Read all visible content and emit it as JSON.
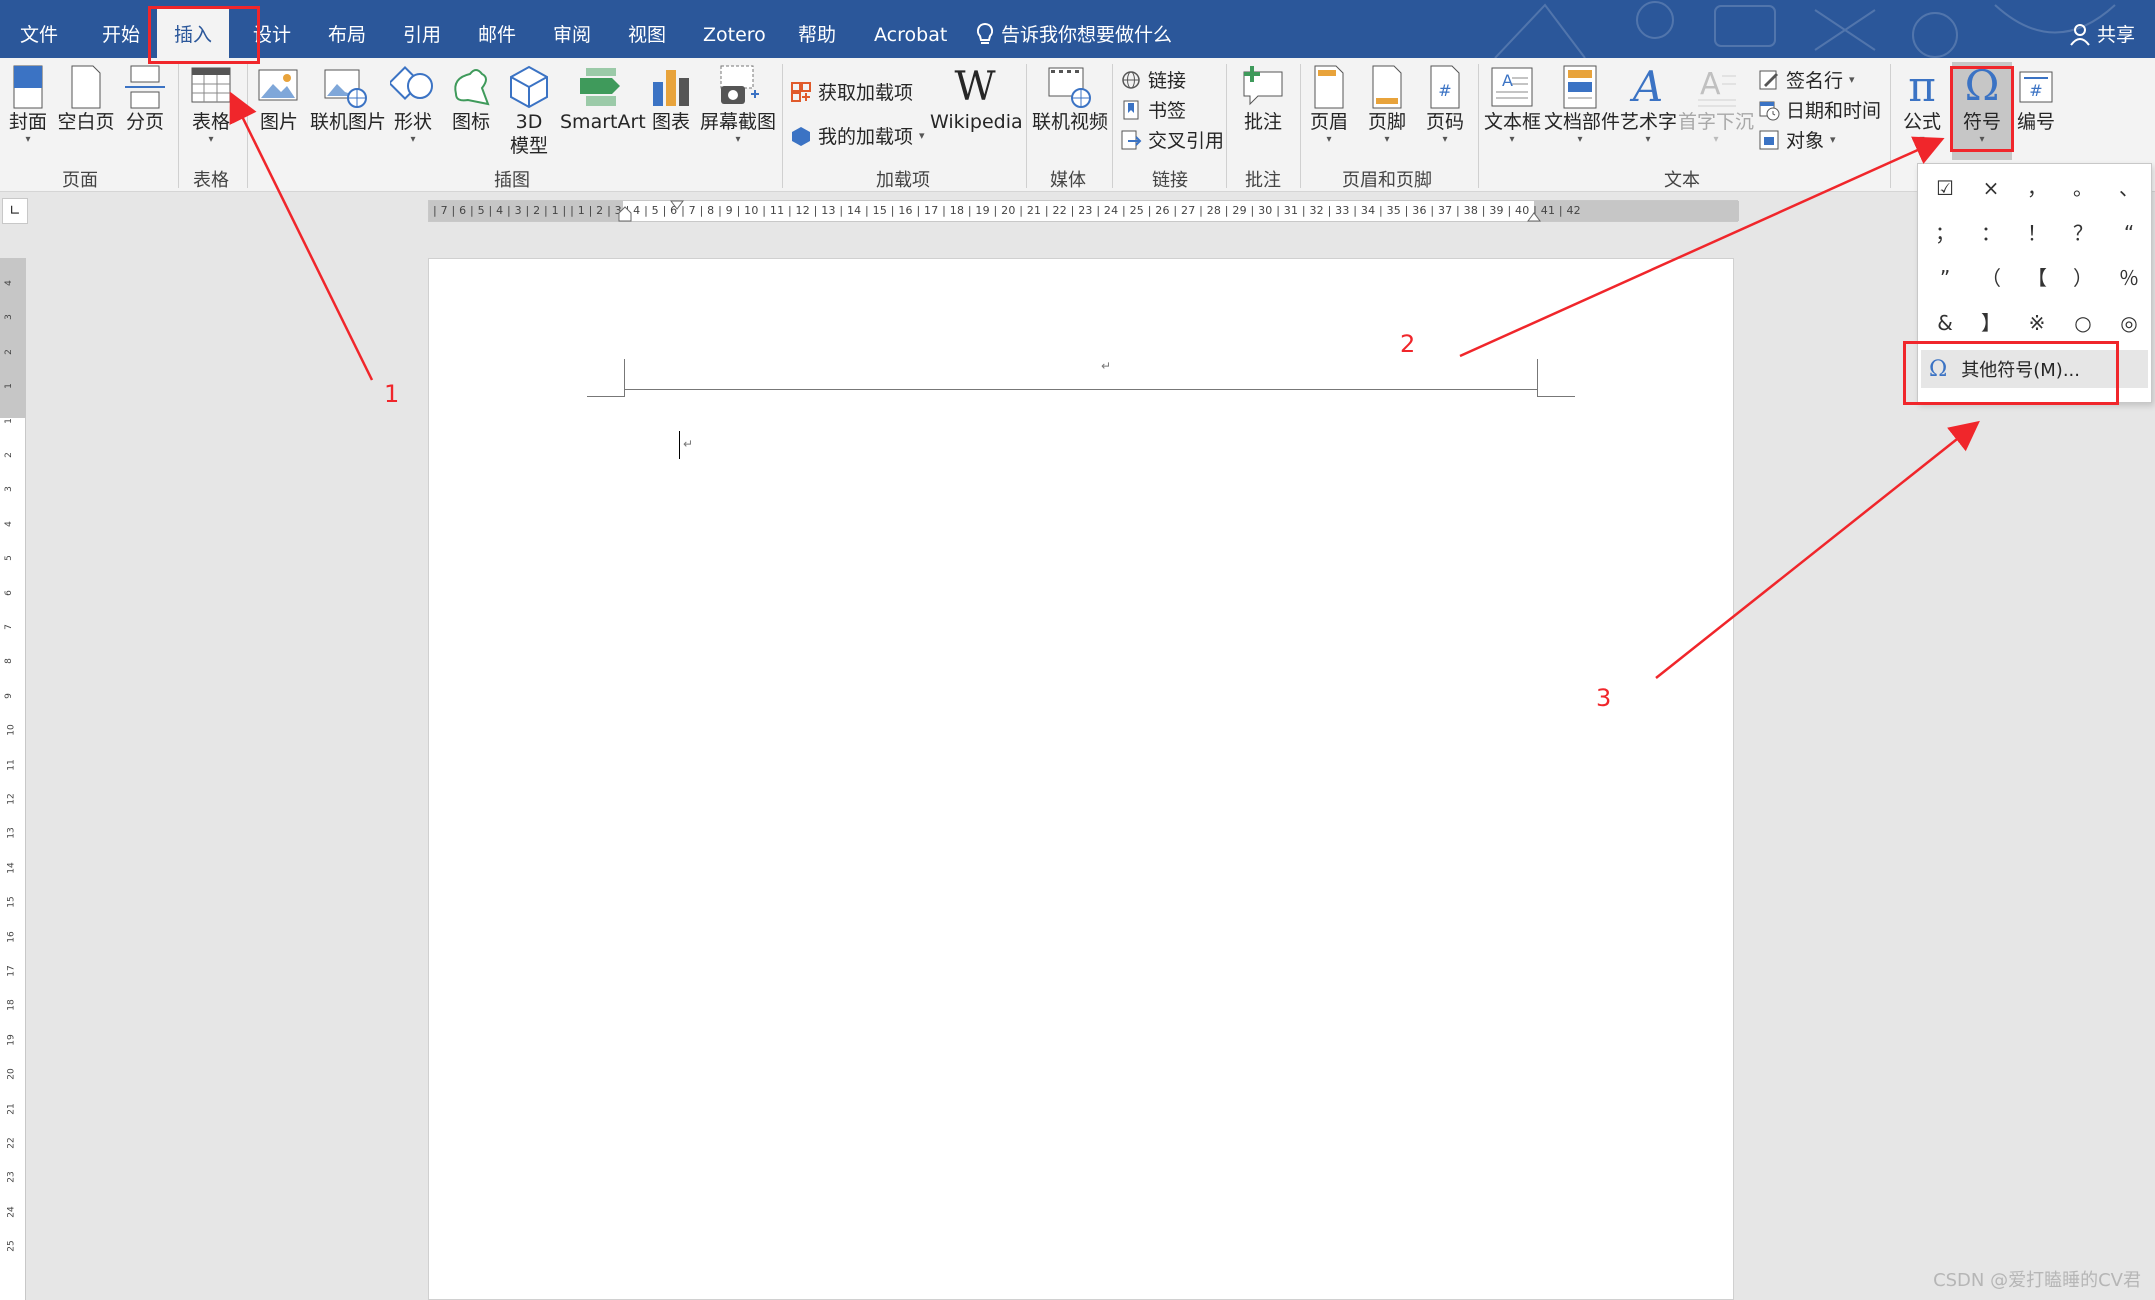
{
  "tabs": {
    "file": "文件",
    "home": "开始",
    "insert": "插入",
    "design": "设计",
    "layout": "布局",
    "references": "引用",
    "mailings": "邮件",
    "review": "审阅",
    "view": "视图",
    "zotero": "Zotero",
    "help": "帮助",
    "acrobat": "Acrobat"
  },
  "tell_me": "告诉我你想要做什么",
  "share": "共享",
  "ribbon": {
    "cover": "封面",
    "blank_page": "空白页",
    "page_break": "分页",
    "table": "表格",
    "picture": "图片",
    "online_picture": "联机图片",
    "shapes": "形状",
    "icons": "图标",
    "model3d_line1": "3D",
    "model3d_line2": "模型",
    "smartart": "SmartArt",
    "chart": "图表",
    "screenshot": "屏幕截图",
    "get_addins": "获取加载项",
    "my_addins": "我的加载项",
    "wikipedia": "Wikipedia",
    "online_video": "联机视频",
    "link": "链接",
    "bookmark": "书签",
    "cross_ref": "交叉引用",
    "comment": "批注",
    "header": "页眉",
    "footer": "页脚",
    "page_number": "页码",
    "textbox": "文本框",
    "quick_parts": "文档部件",
    "wordart": "艺术字",
    "drop_cap": "首字下沉",
    "signature_line": "签名行",
    "date_time": "日期和时间",
    "object": "对象",
    "equation": "公式",
    "symbol": "符号",
    "number": "编号"
  },
  "groups": {
    "pages": "页面",
    "tables": "表格",
    "illustrations": "插图",
    "addins": "加载项",
    "media": "媒体",
    "links": "链接",
    "comments": "批注",
    "header_footer": "页眉和页脚",
    "text": "文本"
  },
  "ruler_text": "| 7 | 6 | 5 | 4 | 3 | 2 | 1 |   | 1 | 2 | 3 | 4 | 5 | 6 | 7 | 8 | 9 | 10 | 11 | 12 | 13 | 14 | 15 | 16 | 17 | 18 | 19 | 20 | 21 | 22 | 23 | 24 | 25 | 26 | 27 | 28 | 29 | 30 | 31 | 32 | 33 | 34 | 35 | 36 | 37 | 38 | 39 | 40 | 41 | 42",
  "vruler_ticks": [
    "4",
    "3",
    "2",
    "1",
    "1",
    "2",
    "3",
    "4",
    "5",
    "6",
    "7",
    "8",
    "9",
    "10",
    "11",
    "12",
    "13",
    "14",
    "15",
    "16",
    "17",
    "18",
    "19",
    "20",
    "21",
    "22",
    "23",
    "24",
    "25"
  ],
  "symbols": [
    "☑",
    "×",
    "，",
    "。",
    "、",
    "；",
    "：",
    "！",
    "？",
    "“",
    "”",
    "（",
    "【",
    "）",
    "％",
    "&",
    "】",
    "※",
    "○",
    "◎"
  ],
  "more_symbols": "其他符号(M)...",
  "annotations": {
    "n1": "1",
    "n2": "2",
    "n3": "3"
  },
  "watermark": "CSDN @爱打瞌睡的CV君",
  "colors": {
    "brand": "#2b579a",
    "annotation": "#f0262b"
  }
}
